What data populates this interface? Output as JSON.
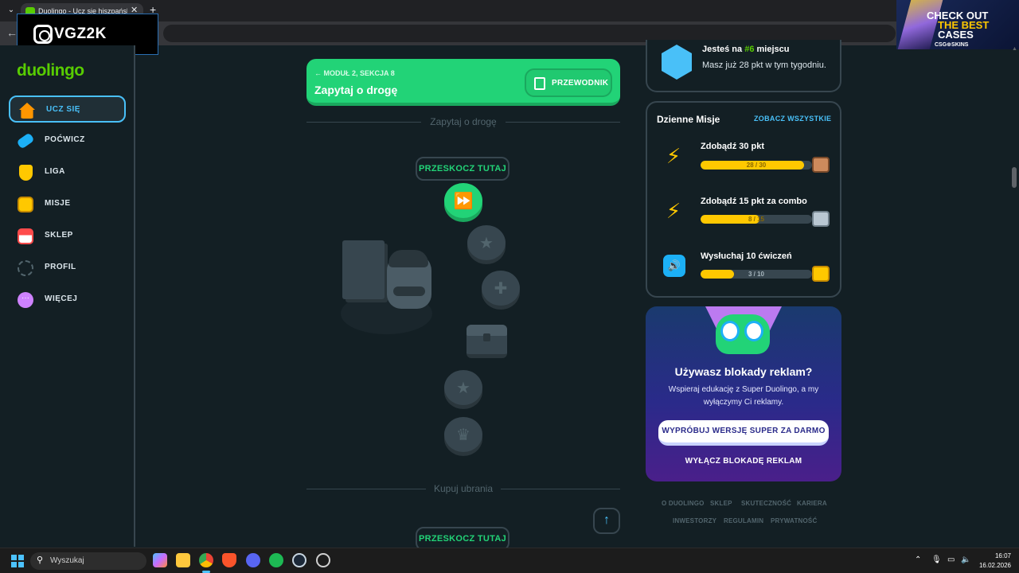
{
  "browser": {
    "tab_title": "Duolingo - Ucz się hiszpańskiego",
    "tab_close": "✕",
    "new_tab": "+"
  },
  "overlay": {
    "streamer_name": "VGZ2K",
    "ad_line1": "CHECK OUT",
    "ad_line2": "THE BEST",
    "ad_line3": "CASES",
    "ad_brand": "CSG⊕SKINS"
  },
  "sidebar": {
    "logo": "duolingo",
    "items": [
      {
        "label": "UCZ SIĘ",
        "icon": "home-icon",
        "color": "#ff9600"
      },
      {
        "label": "POĆWICZ",
        "icon": "dumbbell-icon",
        "color": "#1cb0f6"
      },
      {
        "label": "LIGA",
        "icon": "shield-icon",
        "color": "#ffc800"
      },
      {
        "label": "MISJE",
        "icon": "chest-icon",
        "color": "#ffc800"
      },
      {
        "label": "SKLEP",
        "icon": "shop-icon",
        "color": "#ff4b4b"
      },
      {
        "label": "PROFIL",
        "icon": "profile-icon",
        "color": "#37464f"
      },
      {
        "label": "WIĘCEJ",
        "icon": "more-icon",
        "color": "#ce82ff"
      }
    ]
  },
  "path": {
    "unit_subtitle": "MODUŁ 2, SEKCJA 8",
    "unit_title": "Zapytaj o drogę",
    "guide_button": "PRZEWODNIK",
    "section_label_1": "Zapytaj o drogę",
    "skip_label_1": "PRZESKOCZ TUTAJ",
    "section_label_2": "Kupuj ubrania",
    "skip_label_2": "PRZESKOCZ TUTAJ",
    "scroll_up": "↑"
  },
  "league": {
    "title_pre": "Jesteś na ",
    "rank": "#6",
    "title_post": " miejscu",
    "subtitle": "Masz już 28 pkt w tym tygodniu."
  },
  "missions": {
    "title": "Dzienne Misje",
    "see_all": "ZOBACZ WSZYSTKIE",
    "items": [
      {
        "title": "Zdobądź 30 pkt",
        "progress_text": "28 / 30",
        "progress": 0.93,
        "icon": "bolt-icon",
        "reward": "bronze"
      },
      {
        "title": "Zdobądź 15 pkt za combo",
        "progress_text": "8 / 15",
        "progress": 0.53,
        "icon": "bolt-icon",
        "reward": "silver"
      },
      {
        "title": "Wysłuchaj 10 ćwiczeń",
        "progress_text": "3 / 10",
        "progress": 0.3,
        "icon": "speaker-icon",
        "reward": "gold"
      }
    ]
  },
  "promo": {
    "title": "Używasz blokady reklam?",
    "text": "Wspieraj edukację z Super Duolingo, a my wyłączymy Ci reklamy.",
    "cta": "WYPRÓBUJ WERSJĘ SUPER ZA DARMO",
    "link": "WYŁĄCZ BLOKADĘ REKLAM"
  },
  "footer": {
    "links_row1": [
      "O DUOLINGO",
      "SKLEP",
      "SKUTECZNOŚĆ",
      "KARIERA"
    ],
    "links_row2": [
      "INWESTORZY",
      "REGULAMIN",
      "PRYWATNOŚĆ"
    ]
  },
  "taskbar": {
    "search_placeholder": "Wyszukaj",
    "time": "16:07",
    "date": "16.02.2026"
  }
}
